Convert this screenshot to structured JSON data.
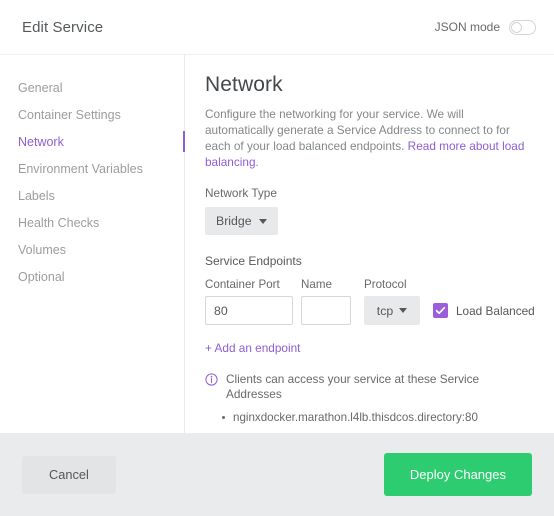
{
  "header": {
    "title": "Edit Service",
    "json_mode_label": "JSON mode",
    "json_mode_on": false
  },
  "sidebar": {
    "items": [
      {
        "label": "General",
        "active": false
      },
      {
        "label": "Container Settings",
        "active": false
      },
      {
        "label": "Network",
        "active": true
      },
      {
        "label": "Environment Variables",
        "active": false
      },
      {
        "label": "Labels",
        "active": false
      },
      {
        "label": "Health Checks",
        "active": false
      },
      {
        "label": "Volumes",
        "active": false
      },
      {
        "label": "Optional",
        "active": false
      }
    ]
  },
  "main": {
    "section_title": "Network",
    "description_text": "Configure the networking for your service. We will automatically generate a Service Address to connect to for each of your load balanced endpoints. ",
    "description_link": "Read more about load balancing",
    "description_trailing": ".",
    "network_type_label": "Network Type",
    "network_type_value": "Bridge",
    "service_endpoints_label": "Service Endpoints",
    "columns": {
      "container_port": "Container Port",
      "name": "Name",
      "protocol": "Protocol"
    },
    "endpoint": {
      "container_port_value": "80",
      "container_port_placeholder": "",
      "name_value": "",
      "name_placeholder": "",
      "protocol_value": "tcp",
      "load_balanced_label": "Load Balanced",
      "load_balanced_checked": true
    },
    "add_endpoint_label": "+ Add an endpoint",
    "info_text": "Clients can access your service at these Service Addresses",
    "service_addresses": [
      "nginxdocker.marathon.l4lb.thisdcos.directory:80"
    ]
  },
  "footer": {
    "cancel_label": "Cancel",
    "deploy_label": "Deploy Changes"
  },
  "colors": {
    "accent_purple": "#8e5ed4",
    "checkbox_purple": "#9a5fd8",
    "deploy_green": "#2dcc70",
    "footer_gray": "#eaebec",
    "muted_text": "#9a9da0"
  }
}
